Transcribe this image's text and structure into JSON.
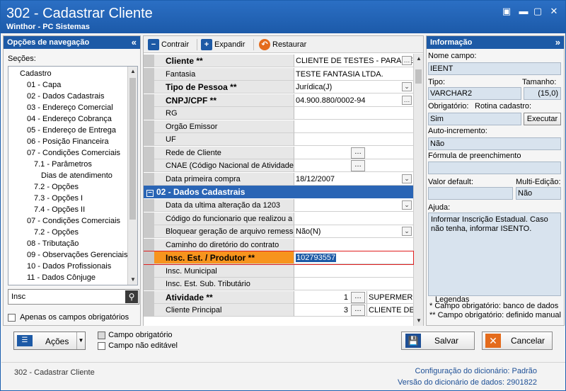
{
  "window": {
    "title": "302 - Cadastrar Cliente",
    "subtitle": "Winthor - PC Sistemas",
    "restore_icon": "restore-icon",
    "minimize_icon": "minimize-icon",
    "close_icon": "close-icon"
  },
  "nav": {
    "header": "Opções de navegação",
    "sections_label": "Seções:",
    "items": [
      {
        "label": "Cadastro",
        "indent": 0
      },
      {
        "label": "01 - Capa",
        "indent": 1
      },
      {
        "label": "02 - Dados Cadastrais",
        "indent": 1
      },
      {
        "label": "03 - Endereço Comercial",
        "indent": 1
      },
      {
        "label": "04 - Endereço Cobrança",
        "indent": 1
      },
      {
        "label": "05 - Endereço de Entrega",
        "indent": 1
      },
      {
        "label": "06 - Posição Financeira",
        "indent": 1
      },
      {
        "label": "07 - Condições Comerciais",
        "indent": 1
      },
      {
        "label": "7.1 - Parâmetros",
        "indent": 2
      },
      {
        "label": "Dias de atendimento",
        "indent": 3
      },
      {
        "label": "7.2 - Opções",
        "indent": 2
      },
      {
        "label": "7.3 - Opções I",
        "indent": 2
      },
      {
        "label": "7.4 - Opções II",
        "indent": 2
      },
      {
        "label": "07 - Condições Comerciais",
        "indent": 1
      },
      {
        "label": "7.2 - Opções",
        "indent": 2
      },
      {
        "label": "08 - Tributação",
        "indent": 1
      },
      {
        "label": "09 - Observações Gerenciais",
        "indent": 1
      },
      {
        "label": "10 - Dados Profissionais",
        "indent": 1
      },
      {
        "label": "11 - Dados Cônjuge",
        "indent": 1
      }
    ],
    "search_value": "Insc",
    "required_only_label": "Apenas os campos obrigatórios"
  },
  "toolbar": {
    "collapse_label": "Contrair",
    "expand_label": "Expandir",
    "restore_label": "Restaurar"
  },
  "grid": {
    "rows_top": [
      {
        "label": "Cliente **",
        "bold": true,
        "value": "CLIENTE DE TESTES - PARAME",
        "control": "ellipsis"
      },
      {
        "label": "Fantasia",
        "bold": false,
        "value": "TESTE FANTASIA LTDA.",
        "control": ""
      },
      {
        "label": "Tipo de Pessoa **",
        "bold": true,
        "value": "Jurídica(J)",
        "control": "dropdown"
      },
      {
        "label": "CNPJ/CPF **",
        "bold": true,
        "value": "04.900.880/0002-94",
        "control": "ellipsis"
      },
      {
        "label": "RG",
        "bold": false,
        "value": "",
        "control": ""
      },
      {
        "label": "Orgão Emissor",
        "bold": false,
        "value": "",
        "control": ""
      },
      {
        "label": "UF",
        "bold": false,
        "value": "",
        "control": ""
      },
      {
        "label": "Rede de Cliente",
        "bold": false,
        "value": "",
        "control": "dots"
      },
      {
        "label": "CNAE (Código Nacional de Atividade E",
        "bold": false,
        "value": "",
        "control": "dots"
      },
      {
        "label": "Data primeira compra",
        "bold": false,
        "value": "18/12/2007",
        "control": "dropdown"
      }
    ],
    "section_title": "02 - Dados Cadastrais",
    "rows_bottom": [
      {
        "label": "Data da ultima alteração da 1203",
        "bold": false,
        "value": "",
        "control": "dropdown"
      },
      {
        "label": "Código do funcionario que realizou a ú",
        "bold": false,
        "value": "",
        "control": ""
      },
      {
        "label": "Bloquear geração de arquivo remessa",
        "bold": false,
        "value": "Não(N)",
        "control": "dropdown"
      },
      {
        "label": "Caminho do diretório do contrato",
        "bold": false,
        "value": "",
        "control": ""
      },
      {
        "label": "Insc. Est. / Produtor **",
        "bold": true,
        "value": "102793557",
        "control": "selected"
      },
      {
        "label": "Insc. Municipal",
        "bold": false,
        "value": "",
        "control": ""
      },
      {
        "label": "Insc. Est. Sub. Tributário",
        "bold": false,
        "value": "",
        "control": ""
      },
      {
        "label": "Atividade **",
        "bold": true,
        "value": "1",
        "extra": "SUPERMERCA",
        "control": "split"
      },
      {
        "label": "Cliente Principal",
        "bold": false,
        "value": "3",
        "extra": "CLIENTE DE T",
        "control": "split"
      }
    ]
  },
  "info": {
    "header": "Informação",
    "field_name_label": "Nome campo:",
    "field_name": "IEENT",
    "type_label": "Tipo:",
    "type_value": "VARCHAR2",
    "size_label": "Tamanho:",
    "size_value": "(15,0)",
    "required_label": "Obrigatório:",
    "required_value": "Sim",
    "routine_label": "Rotina cadastro:",
    "execute_label": "Executar",
    "autoinc_label": "Auto-incremento:",
    "autoinc_value": "Não",
    "formula_label": "Fórmula de preenchimento",
    "formula_value": "",
    "default_label": "Valor default:",
    "default_value": "",
    "multi_label": "Multi-Edição:",
    "multi_value": "Não",
    "help_label": "Ajuda:",
    "help_text": "Informar Inscrição Estadual. Caso não tenha, informar ISENTO.",
    "legend_title": "Legendas",
    "legend_1": "* Campo obrigatório: banco de dados",
    "legend_2": "** Campo obrigatório: definido manual"
  },
  "actions": {
    "actions_label": "Ações",
    "legend_required": "Campo obrigatório",
    "legend_noneditable": "Campo não editável",
    "save_label": "Salvar",
    "cancel_label": "Cancelar"
  },
  "footer": {
    "routine": "302 - Cadastrar Cliente",
    "config_label": "Configuração do dicionário:",
    "config_value": "Padrão",
    "version_label": "Versão do dicionário de dados:",
    "version_value": "2901822"
  },
  "colors": {
    "title_bar": "#1f5fb0",
    "section_header": "#2a65b5",
    "selected_row": "#f7941d",
    "selected_border": "#e02020",
    "info_box": "#d8e3ee"
  }
}
